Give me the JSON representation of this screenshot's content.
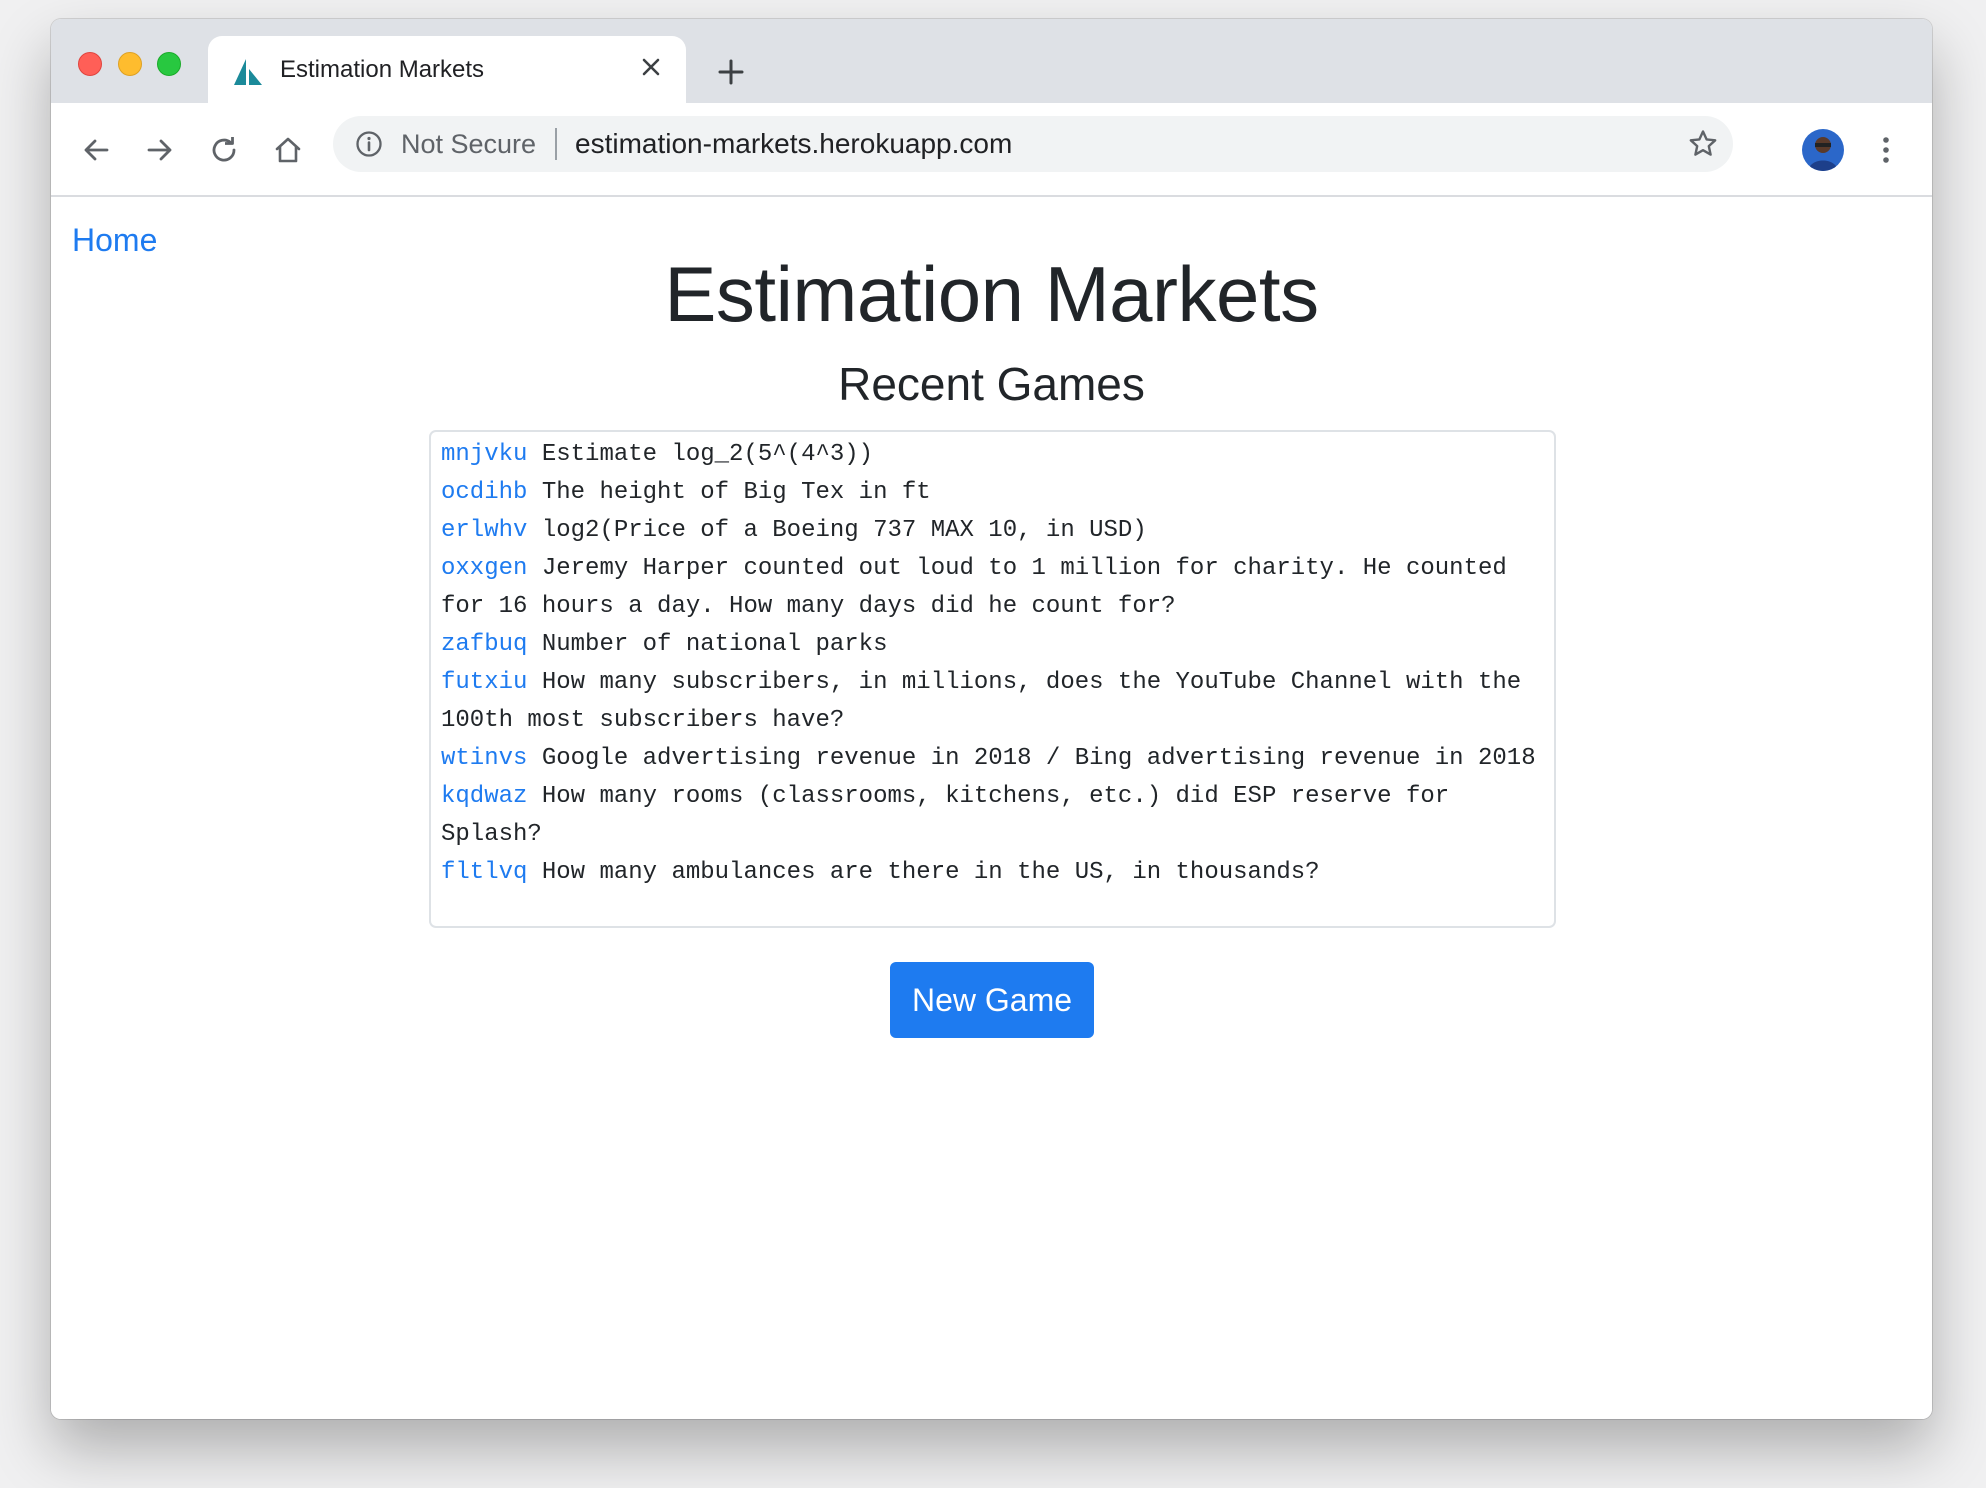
{
  "browser": {
    "tab_title": "Estimation Markets",
    "security_label": "Not Secure",
    "url": "estimation-markets.herokuapp.com"
  },
  "page": {
    "home_link": "Home",
    "title": "Estimation Markets",
    "section_title": "Recent Games",
    "new_game_button": "New Game",
    "games": [
      {
        "id": "mnjvku",
        "question": "Estimate log_2(5^(4^3))"
      },
      {
        "id": "ocdihb",
        "question": "The height of Big Tex in ft"
      },
      {
        "id": "erlwhv",
        "question": "log2(Price of a Boeing 737 MAX 10, in USD)"
      },
      {
        "id": "oxxgen",
        "question": "Jeremy Harper counted out loud to 1 million for charity. He counted for 16 hours a day. How many days did he count for?"
      },
      {
        "id": "zafbuq",
        "question": "Number of national parks"
      },
      {
        "id": "futxiu",
        "question": "How many subscribers, in millions, does the YouTube Channel with the 100th most subscribers have?"
      },
      {
        "id": "wtinvs",
        "question": "Google advertising revenue in 2018 / Bing advertising revenue in 2018"
      },
      {
        "id": "kqdwaz",
        "question": "How many rooms (classrooms, kitchens, etc.) did ESP reserve for Splash?"
      },
      {
        "id": "fltlvq",
        "question": "How many ambulances are there in the US, in thousands?"
      }
    ]
  },
  "colors": {
    "link": "#1e7bf0",
    "button": "#1e7bf0",
    "text": "#212529"
  }
}
